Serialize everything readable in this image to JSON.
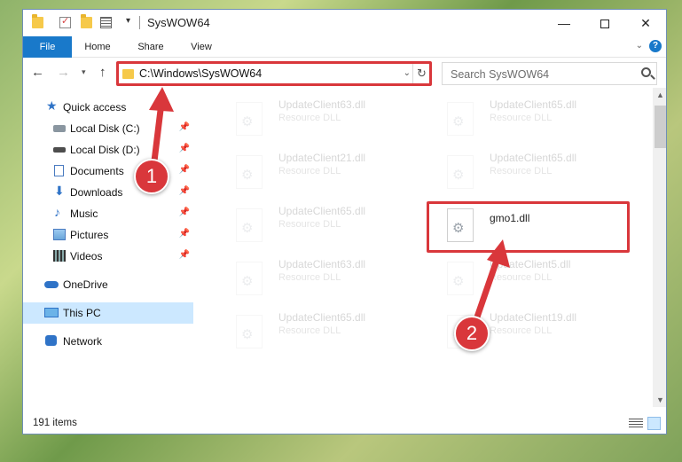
{
  "window": {
    "title": "SysWOW64",
    "minimize_glyph": "—",
    "close_glyph": "✕"
  },
  "quick_access_toolbar": {
    "dropdown_glyph": "▾"
  },
  "ribbon": {
    "tabs": [
      {
        "label": "File"
      },
      {
        "label": "Home"
      },
      {
        "label": "Share"
      },
      {
        "label": "View"
      }
    ],
    "expand_glyph": "⌄",
    "help_glyph": "?"
  },
  "nav": {
    "back_glyph": "←",
    "forward_glyph": "→",
    "recent_glyph": "▾",
    "up_glyph": "↑",
    "address": "C:\\Windows\\SysWOW64",
    "address_dropdown_glyph": "⌄",
    "refresh_glyph": "↻",
    "search_placeholder": "Search SysWOW64"
  },
  "sidebar": {
    "items": [
      {
        "label": "Quick access",
        "icon": "star-icon"
      },
      {
        "label": "Local Disk (C:)",
        "icon": "drive-icon",
        "pinned": true
      },
      {
        "label": "Local Disk (D:)",
        "icon": "drive-icon",
        "pinned": true
      },
      {
        "label": "Documents",
        "icon": "documents-icon",
        "pinned": true
      },
      {
        "label": "Downloads",
        "icon": "download-icon",
        "pinned": true
      },
      {
        "label": "Music",
        "icon": "music-icon",
        "pinned": true
      },
      {
        "label": "Pictures",
        "icon": "pictures-icon",
        "pinned": true
      },
      {
        "label": "Videos",
        "icon": "videos-icon",
        "pinned": true
      },
      {
        "label": "OneDrive",
        "icon": "cloud-icon"
      },
      {
        "label": "This PC",
        "icon": "computer-icon",
        "selected": true
      },
      {
        "label": "Network",
        "icon": "network-icon"
      }
    ],
    "pin_glyph": "📌",
    "star_glyph": "★",
    "download_glyph": "⬇",
    "music_glyph": "♪"
  },
  "files": [
    {
      "name": "UpdateClient63.dll",
      "type": "Resource DLL"
    },
    {
      "name": "UpdateClient65.dll",
      "type": "Resource DLL"
    },
    {
      "name": "UpdateClient21.dll",
      "type": "Resource DLL"
    },
    {
      "name": "UpdateClient65.dll",
      "type": "Resource DLL"
    },
    {
      "name": "UpdateClient65.dll",
      "type": "Resource DLL"
    },
    {
      "name": "gmo1.dll",
      "type": ""
    },
    {
      "name": "UpdateClient63.dll",
      "type": "Resource DLL"
    },
    {
      "name": "UpdateClient5.dll",
      "type": "Resource DLL"
    },
    {
      "name": "UpdateClient65.dll",
      "type": "Resource DLL"
    },
    {
      "name": "UpdateClient19.dll",
      "type": "Resource DLL"
    }
  ],
  "scrollbar": {
    "up_glyph": "▲",
    "down_glyph": "▼"
  },
  "status": {
    "item_count": "191 items"
  },
  "annotations": {
    "step1": "1",
    "step2": "2",
    "color": "#d9373b"
  }
}
